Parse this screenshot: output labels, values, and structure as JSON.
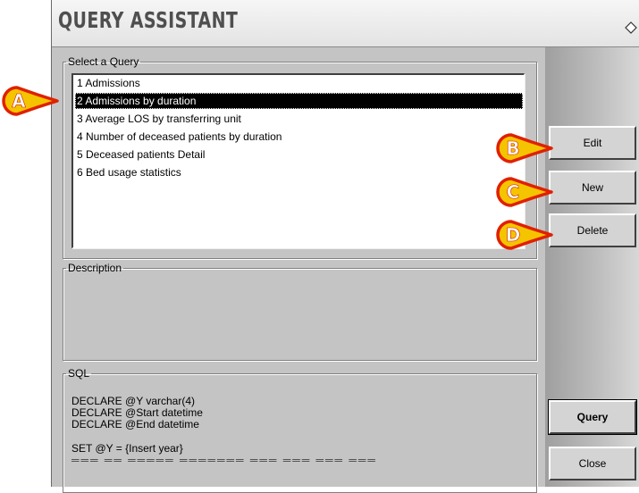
{
  "window": {
    "title": "QUERY ASSISTANT"
  },
  "query_group": {
    "legend": "Select a Query",
    "items": [
      {
        "label": "1 Admissions"
      },
      {
        "label": "2 Admissions by duration",
        "selected": true
      },
      {
        "label": "3 Average LOS by transferring unit"
      },
      {
        "label": "4 Number of deceased patients by duration"
      },
      {
        "label": "5 Deceased patients Detail"
      },
      {
        "label": "6 Bed usage statistics"
      }
    ]
  },
  "description_group": {
    "legend": "Description"
  },
  "sql_group": {
    "legend": "SQL",
    "lines": [
      "DECLARE @Y varchar(4)",
      "DECLARE @Start datetime",
      "DECLARE @End datetime",
      "",
      "SET @Y = {Insert year}"
    ]
  },
  "buttons": {
    "edit": "Edit",
    "new": "New",
    "delete": "Delete",
    "query": "Query",
    "close": "Close"
  },
  "callouts": {
    "a": "A",
    "b": "B",
    "c": "C",
    "d": "D"
  },
  "colors": {
    "callout_fill": "#f5c400",
    "callout_border": "#e02000",
    "selection": "#000000"
  }
}
